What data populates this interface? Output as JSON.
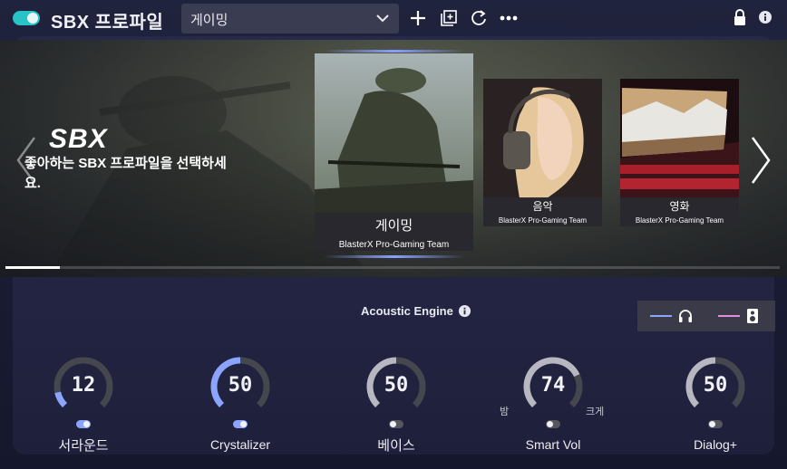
{
  "header": {
    "app_title": "SBX 프로파일",
    "profile_selected": "게이밍",
    "enabled": true
  },
  "carousel": {
    "logo_text": "SBX",
    "description": "좋아하는 SBX 프로파일을 선택하세요.",
    "progress": 0.07,
    "cards": [
      {
        "title": "게이밍",
        "subtitle": "BlasterX Pro-Gaming Team",
        "selected": true
      },
      {
        "title": "음악",
        "subtitle": "BlasterX Pro-Gaming Team",
        "selected": false
      },
      {
        "title": "영화",
        "subtitle": "BlasterX Pro-Gaming Team",
        "selected": false
      }
    ]
  },
  "acoustic": {
    "title": "Acoustic Engine",
    "legend": [
      {
        "icon": "headphones-icon",
        "color": "#8aa4ff"
      },
      {
        "icon": "speaker-icon",
        "color": "#e08fe0"
      }
    ],
    "knobs": [
      {
        "label": "서라운드",
        "value": "12",
        "enabled": true
      },
      {
        "label": "Crystalizer",
        "value": "50",
        "enabled": true
      },
      {
        "label": "베이스",
        "value": "50",
        "enabled": false
      },
      {
        "label": "Smart Vol",
        "value": "74",
        "enabled": false,
        "left_label": "밤",
        "right_label": "크게"
      },
      {
        "label": "Dialog+",
        "value": "50",
        "enabled": false
      }
    ]
  },
  "colors": {
    "accent": "#27c3c7",
    "active_arc": "#8aa4ff",
    "inactive_arc": "#b6b7c0",
    "track": "#45474e"
  }
}
